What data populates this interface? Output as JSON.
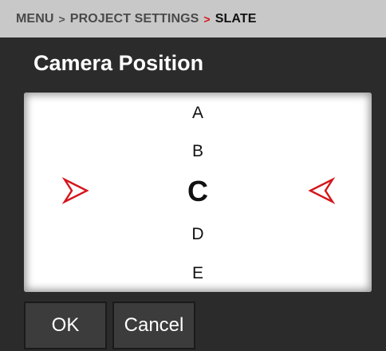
{
  "breadcrumb": {
    "items": [
      "MENU",
      "PROJECT SETTINGS",
      "SLATE"
    ],
    "separator": ">"
  },
  "title": "Camera Position",
  "picker": {
    "options": [
      "A",
      "B",
      "C",
      "D",
      "E"
    ],
    "selected": "C"
  },
  "buttons": {
    "ok": "OK",
    "cancel": "Cancel"
  },
  "colors": {
    "accent": "#d4161c",
    "header_bg": "#c8c8c8",
    "body_bg": "#2b2b2b"
  },
  "icons": {
    "left": "chevron-right-outline-icon",
    "right": "chevron-left-outline-icon"
  }
}
